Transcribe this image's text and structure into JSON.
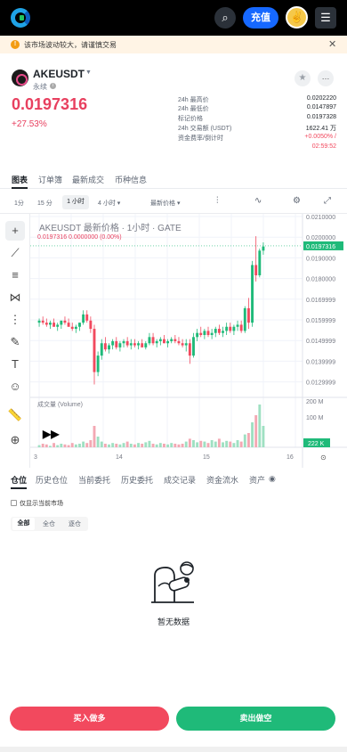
{
  "header": {
    "search_icon": "search-icon",
    "deposit_label": "充值",
    "avatar_icon": "avatar-icon",
    "menu_icon": "menu-icon"
  },
  "notice": {
    "text": "该市场波动较大，请谨慎交易",
    "icon": "!",
    "close": "✕"
  },
  "ticker": {
    "symbol": "AKEUSDT",
    "type": "永续",
    "price": "0.0197316",
    "change": "+27.53%",
    "stats": [
      {
        "label": "24h 最高价",
        "value": "0.0202220"
      },
      {
        "label": "24h 最低价",
        "value": "0.0147897"
      },
      {
        "label": "标记价格",
        "value": "0.0197328"
      },
      {
        "label": "24h 交易额 (USDT)",
        "value": "1622.41 万"
      },
      {
        "label": "资金费率/倒计时",
        "value": "+0.0050% /"
      },
      {
        "label": "",
        "value": "02:59:52"
      }
    ]
  },
  "tabs": [
    "图表",
    "订单簿",
    "最新成交",
    "币种信息"
  ],
  "chart_toolbar": {
    "intervals": [
      "1分",
      "15 分",
      "1 小时",
      "4 小时 ▾"
    ],
    "price_type": "最新价格 ▾"
  },
  "chart": {
    "title": "AKEUSDT 最新价格 · 1小时 · GATE",
    "ohlc": "0.0197316  0.0000000 (0.00%)",
    "current_price_label": "0.0197316",
    "volume_label": "成交量 (Volume)",
    "volume_current": "222 K",
    "price_ticks": [
      "0.0210000",
      "0.0200000",
      "0.0190000",
      "0.0180000",
      "0.0169999",
      "0.0159999",
      "0.0149999",
      "0.0139999",
      "0.0129999"
    ],
    "volume_ticks": [
      "200 M",
      "100 M"
    ],
    "date_ticks": [
      "3",
      "14",
      "15",
      "16"
    ]
  },
  "chart_data": {
    "type": "candlestick",
    "title": "AKEUSDT 最新价格 · 1小时 · GATE",
    "ylim": [
      0.0125,
      0.0212
    ],
    "x_ticks": [
      "3",
      "14",
      "15",
      "16"
    ],
    "candles": [
      [
        0.016,
        0.0162,
        0.0158,
        0.0161
      ],
      [
        0.0161,
        0.0163,
        0.0159,
        0.016
      ],
      [
        0.016,
        0.0162,
        0.0158,
        0.0159
      ],
      [
        0.0159,
        0.0161,
        0.0157,
        0.016
      ],
      [
        0.016,
        0.0162,
        0.0158,
        0.0158
      ],
      [
        0.0158,
        0.016,
        0.0156,
        0.0159
      ],
      [
        0.0159,
        0.0161,
        0.0157,
        0.0161
      ],
      [
        0.0161,
        0.0163,
        0.0159,
        0.016
      ],
      [
        0.016,
        0.0162,
        0.0158,
        0.0158
      ],
      [
        0.0158,
        0.016,
        0.0156,
        0.0157
      ],
      [
        0.0157,
        0.0159,
        0.0155,
        0.0158
      ],
      [
        0.0158,
        0.016,
        0.0156,
        0.016
      ],
      [
        0.016,
        0.0166,
        0.0159,
        0.0164
      ],
      [
        0.0164,
        0.0166,
        0.016,
        0.0161
      ],
      [
        0.0161,
        0.0163,
        0.0155,
        0.0157
      ],
      [
        0.0157,
        0.0159,
        0.013,
        0.0136
      ],
      [
        0.0136,
        0.0146,
        0.0134,
        0.0144
      ],
      [
        0.0144,
        0.0152,
        0.0142,
        0.015
      ],
      [
        0.015,
        0.0153,
        0.0146,
        0.0147
      ],
      [
        0.0147,
        0.015,
        0.0145,
        0.0149
      ],
      [
        0.0149,
        0.0152,
        0.0147,
        0.0151
      ],
      [
        0.0151,
        0.0153,
        0.0147,
        0.0148
      ],
      [
        0.0148,
        0.0151,
        0.0146,
        0.015
      ],
      [
        0.015,
        0.0152,
        0.0148,
        0.0151
      ],
      [
        0.0151,
        0.0153,
        0.0148,
        0.0149
      ],
      [
        0.0149,
        0.0152,
        0.0147,
        0.015
      ],
      [
        0.015,
        0.0152,
        0.0148,
        0.0149
      ],
      [
        0.0149,
        0.0151,
        0.0147,
        0.015
      ],
      [
        0.015,
        0.0152,
        0.0148,
        0.0148
      ],
      [
        0.0148,
        0.0151,
        0.0147,
        0.015
      ],
      [
        0.015,
        0.0155,
        0.0149,
        0.0153
      ],
      [
        0.0153,
        0.0155,
        0.0149,
        0.015
      ],
      [
        0.015,
        0.0152,
        0.0148,
        0.0151
      ],
      [
        0.0151,
        0.0153,
        0.0149,
        0.0152
      ],
      [
        0.0152,
        0.0154,
        0.015,
        0.015
      ],
      [
        0.015,
        0.0152,
        0.0148,
        0.0151
      ],
      [
        0.0151,
        0.0153,
        0.015,
        0.0152
      ],
      [
        0.0152,
        0.0154,
        0.015,
        0.0151
      ],
      [
        0.0151,
        0.0153,
        0.0149,
        0.015
      ],
      [
        0.015,
        0.0152,
        0.0148,
        0.0149
      ],
      [
        0.0149,
        0.0152,
        0.0146,
        0.015
      ],
      [
        0.015,
        0.0152,
        0.014,
        0.0144
      ],
      [
        0.0144,
        0.0155,
        0.0143,
        0.0153
      ],
      [
        0.0153,
        0.0157,
        0.0151,
        0.0155
      ],
      [
        0.0155,
        0.0158,
        0.0153,
        0.0154
      ],
      [
        0.0154,
        0.0157,
        0.0152,
        0.0156
      ],
      [
        0.0156,
        0.0158,
        0.0153,
        0.0154
      ],
      [
        0.0154,
        0.0157,
        0.0152,
        0.0155
      ],
      [
        0.0155,
        0.0158,
        0.0153,
        0.0157
      ],
      [
        0.0157,
        0.0159,
        0.0154,
        0.0155
      ],
      [
        0.0155,
        0.0158,
        0.0153,
        0.0156
      ],
      [
        0.0156,
        0.016,
        0.0154,
        0.0158
      ],
      [
        0.0158,
        0.016,
        0.0155,
        0.0156
      ],
      [
        0.0156,
        0.0159,
        0.0154,
        0.0158
      ],
      [
        0.0158,
        0.0161,
        0.0156,
        0.0159
      ],
      [
        0.0159,
        0.0161,
        0.0155,
        0.0156
      ],
      [
        0.0156,
        0.0168,
        0.0155,
        0.0167
      ],
      [
        0.0167,
        0.0172,
        0.0157,
        0.016
      ],
      [
        0.016,
        0.019,
        0.0158,
        0.0188
      ],
      [
        0.0188,
        0.0202,
        0.018,
        0.0183
      ],
      [
        0.0183,
        0.0196,
        0.0182,
        0.0195
      ],
      [
        0.0195,
        0.0199,
        0.0193,
        0.0197
      ]
    ],
    "volume_ticks": [
      "200 M",
      "100 M"
    ],
    "volumes": [
      3,
      5,
      4,
      2,
      6,
      3,
      5,
      4,
      3,
      6,
      4,
      5,
      8,
      6,
      10,
      30,
      15,
      8,
      5,
      4,
      6,
      5,
      4,
      6,
      8,
      5,
      4,
      6,
      5,
      7,
      9,
      5,
      4,
      6,
      5,
      4,
      6,
      5,
      4,
      5,
      8,
      12,
      10,
      7,
      9,
      8,
      6,
      10,
      8,
      12,
      7,
      9,
      8,
      6,
      10,
      8,
      18,
      20,
      35,
      45,
      60,
      30
    ]
  },
  "positions": {
    "tabs": [
      "仓位",
      "历史仓位",
      "当前委托",
      "历史委托",
      "成交记录",
      "资金流水",
      "资产"
    ],
    "only_current": "仅显示当前市场",
    "filters": [
      "全部",
      "全仓",
      "逐仓"
    ],
    "empty": "暂无数据"
  },
  "actions": {
    "buy": "买入做多",
    "sell": "卖出做空"
  },
  "colors": {
    "up": "#1fba79",
    "down": "#f2495e",
    "accent": "#1668ff"
  }
}
